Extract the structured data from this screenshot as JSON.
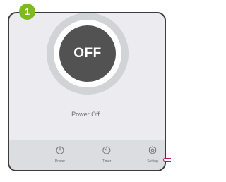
{
  "step": {
    "number": "1",
    "color": "#7dba1f"
  },
  "dial": {
    "state_label": "OFF",
    "button_color": "#525252"
  },
  "status": {
    "text": "Power Off"
  },
  "nav": {
    "items": [
      {
        "label": "Power",
        "icon": "power-icon"
      },
      {
        "label": "Timer",
        "icon": "timer-icon"
      },
      {
        "label": "Setting",
        "icon": "setting-icon"
      }
    ]
  },
  "highlight_color": "#c0136b"
}
